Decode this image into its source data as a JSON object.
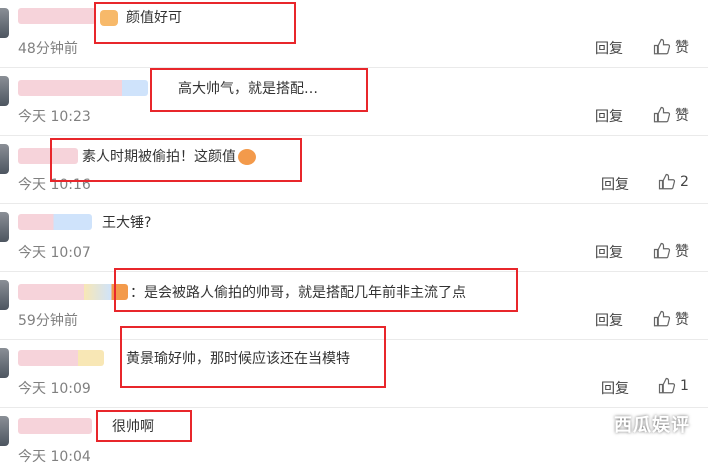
{
  "comments": [
    {
      "text": "颜值好可",
      "time": "48分钟前",
      "reply": "回复",
      "like": "赞"
    },
    {
      "text": "高大帅气，就是搭配…",
      "time": "今天 10:23",
      "reply": "回复",
      "like": "赞"
    },
    {
      "text": "素人时期被偷拍！这颜值",
      "time": "今天 10:16",
      "reply": "回复",
      "like": "2"
    },
    {
      "text": "王大锤?",
      "time": "今天 10:07",
      "reply": "回复",
      "like": "赞"
    },
    {
      "text": "是会被路人偷拍的帅哥，就是搭配几年前非主流了点",
      "time": "59分钟前",
      "reply": "回复",
      "like": "赞"
    },
    {
      "text": "黄景瑜好帅，那时候应该还在当模特",
      "time": "今天 10:09",
      "reply": "回复",
      "like": "1"
    },
    {
      "text": "很帅啊",
      "time": "今天 10:04",
      "reply": "回复",
      "like": "赞"
    }
  ],
  "watermark": "西瓜娱评",
  "colors": {
    "highlight": "#e8262b",
    "blur_pink": "#f6d3da",
    "blur_blue": "#cfe3fb",
    "blur_yellow": "#f8e7b5"
  }
}
